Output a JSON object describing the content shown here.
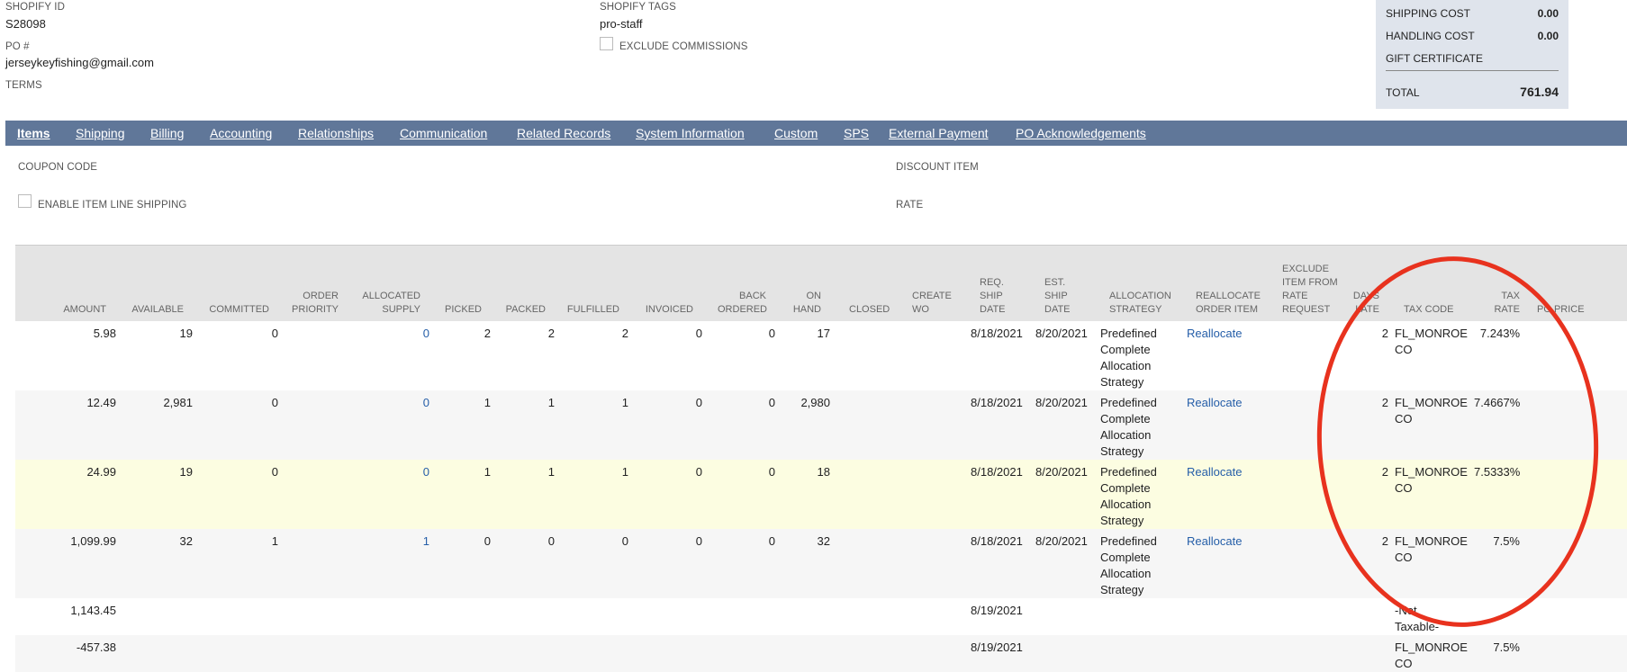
{
  "header_fields": {
    "shopify_id_label": "SHOPIFY ID",
    "shopify_id_value": "S28098",
    "po_label": "PO #",
    "po_value": "jerseykeyfishing@gmail.com",
    "terms_label": "TERMS",
    "shopify_tags_label": "SHOPIFY TAGS",
    "shopify_tags_value": "pro-staff",
    "exclude_commissions_label": "EXCLUDE COMMISSIONS"
  },
  "summary": {
    "shipping_cost_label": "SHIPPING COST",
    "shipping_cost_value": "0.00",
    "handling_cost_label": "HANDLING COST",
    "handling_cost_value": "0.00",
    "gift_certificate_label": "GIFT CERTIFICATE",
    "total_label": "TOTAL",
    "total_value": "761.94"
  },
  "tabs": [
    {
      "label": "Items"
    },
    {
      "label": "Shipping"
    },
    {
      "label": "Billing"
    },
    {
      "label": "Accounting"
    },
    {
      "label": "Relationships"
    },
    {
      "label": "Communication"
    },
    {
      "label": "Related Records"
    },
    {
      "label": "System Information"
    },
    {
      "label": "Custom"
    },
    {
      "label": "SPS"
    },
    {
      "label": "External Payment"
    },
    {
      "label": "PO Acknowledgements"
    }
  ],
  "items_form": {
    "coupon_code_label": "COUPON CODE",
    "discount_item_label": "DISCOUNT ITEM",
    "enable_line_shipping_label": "ENABLE ITEM LINE SHIPPING",
    "rate_label": "RATE"
  },
  "columns": {
    "amount": "AMOUNT",
    "available": "AVAILABLE",
    "committed": "COMMITTED",
    "order_priority": "ORDER PRIORITY",
    "allocated_supply": "ALLOCATED SUPPLY",
    "picked": "PICKED",
    "packed": "PACKED",
    "fulfilled": "FULFILLED",
    "invoiced": "INVOICED",
    "back_ordered": "BACK ORDERED",
    "on_hand": "ON HAND",
    "closed": "CLOSED",
    "create_wo": "CREATE WO",
    "req_ship_date": "REQ. SHIP DATE",
    "est_ship_date": "EST. SHIP DATE",
    "allocation_strategy": "ALLOCATION STRATEGY",
    "reallocate_order_item": "REALLOCATE ORDER ITEM",
    "exclude_item": "EXCLUDE ITEM FROM RATE REQUEST",
    "days_late": "DAYS LATE",
    "tax_code": "TAX CODE",
    "tax_rate": "TAX RATE",
    "po_price": "PO PRICE"
  },
  "rows": [
    {
      "amount": "5.98",
      "available": "19",
      "committed": "0",
      "allocated": "0",
      "picked": "2",
      "packed": "2",
      "fulfilled": "2",
      "invoiced": "0",
      "back_ordered": "0",
      "on_hand": "17",
      "req_date": "8/18/2021",
      "est_date": "8/20/2021",
      "strategy": "Predefined Complete Allocation Strategy",
      "reallocate": "Reallocate",
      "days_late": "2",
      "tax_code": "FL_MONROE CO",
      "tax_rate": "7.243%"
    },
    {
      "amount": "12.49",
      "available": "2,981",
      "committed": "0",
      "allocated": "0",
      "picked": "1",
      "packed": "1",
      "fulfilled": "1",
      "invoiced": "0",
      "back_ordered": "0",
      "on_hand": "2,980",
      "req_date": "8/18/2021",
      "est_date": "8/20/2021",
      "strategy": "Predefined Complete Allocation Strategy",
      "reallocate": "Reallocate",
      "days_late": "2",
      "tax_code": "FL_MONROE CO",
      "tax_rate": "7.4667%"
    },
    {
      "amount": "24.99",
      "available": "19",
      "committed": "0",
      "allocated": "0",
      "picked": "1",
      "packed": "1",
      "fulfilled": "1",
      "invoiced": "0",
      "back_ordered": "0",
      "on_hand": "18",
      "req_date": "8/18/2021",
      "est_date": "8/20/2021",
      "strategy": "Predefined Complete Allocation Strategy",
      "reallocate": "Reallocate",
      "days_late": "2",
      "tax_code": "FL_MONROE CO",
      "tax_rate": "7.5333%"
    },
    {
      "amount": "1,099.99",
      "available": "32",
      "committed": "1",
      "allocated": "1",
      "picked": "0",
      "packed": "0",
      "fulfilled": "0",
      "invoiced": "0",
      "back_ordered": "0",
      "on_hand": "32",
      "req_date": "8/18/2021",
      "est_date": "8/20/2021",
      "strategy": "Predefined Complete Allocation Strategy",
      "reallocate": "Reallocate",
      "days_late": "2",
      "tax_code": "FL_MONROE CO",
      "tax_rate": "7.5%"
    },
    {
      "amount": "1,143.45",
      "req_date": "8/19/2021",
      "tax_code": "-Not Taxable-"
    },
    {
      "amount": "-457.38",
      "req_date": "8/19/2021",
      "tax_code": "FL_MONROE CO",
      "tax_rate": "7.5%"
    }
  ]
}
